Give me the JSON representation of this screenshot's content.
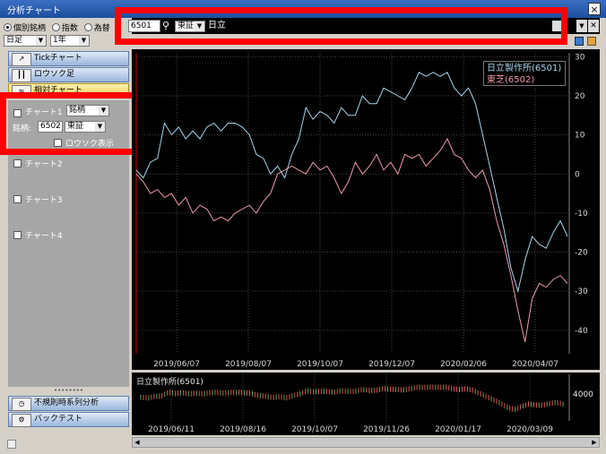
{
  "window": {
    "title": "分析チャート",
    "close": "×"
  },
  "top_controls": {
    "radio_individual": "個別銘柄",
    "radio_index": "指数",
    "radio_fx": "為替",
    "period_value": "日足",
    "range_value": "1年"
  },
  "nav": {
    "tick": "Tickチャート",
    "candle": "ロウソク足",
    "compare": "相対チャート"
  },
  "chart_list": {
    "chart1": "チャート1",
    "chart1_type": "銘柄",
    "code_label": "銘柄:",
    "chart1_code": "6502",
    "chart1_market": "東証",
    "candle_display": "ロウソク表示",
    "chart2": "チャート2",
    "chart3": "チャート3",
    "chart4": "チャート4"
  },
  "bottom_nav": {
    "irregular": "不規則時系列分析",
    "backtest": "バックテスト"
  },
  "search": {
    "code": "6501",
    "market": "東証",
    "name": "日立"
  },
  "chart_data": [
    {
      "type": "line",
      "legend_placement": "top-right",
      "ylim": [
        -46,
        31
      ],
      "yticks": [
        30,
        20,
        10,
        0,
        -10,
        -20,
        -30,
        -40
      ],
      "xtick_labels": [
        "2019/06/07",
        "2019/08/07",
        "2019/10/07",
        "2019/12/07",
        "2020/02/06",
        "2020/04/07"
      ],
      "grid": true,
      "colors": {
        "hitachi": "#a8d4ea",
        "toshiba": "#ef9aa8"
      },
      "series": [
        {
          "name": "日立製作所(6501)",
          "values": [
            1,
            -1,
            3,
            4,
            13,
            10,
            12,
            9,
            11,
            9,
            12,
            13,
            11,
            13,
            13,
            12,
            10,
            5,
            4,
            0,
            2,
            -1,
            5,
            9,
            17,
            14,
            16,
            15,
            13,
            17,
            15,
            15,
            20,
            18,
            18,
            22,
            21,
            20,
            19,
            22,
            26,
            25,
            26,
            25,
            26,
            22,
            20,
            22,
            18,
            10,
            2,
            -6,
            -14,
            -24,
            -30,
            -22,
            -16,
            -18,
            -19,
            -15,
            -12,
            -16
          ]
        },
        {
          "name": "東芝(6502)",
          "values": [
            0,
            -2,
            -5,
            -4,
            -6,
            -5,
            -8,
            -6,
            -10,
            -8,
            -9,
            -12,
            -11,
            -12,
            -10,
            -9,
            -8,
            -10,
            -7,
            -5,
            0,
            1,
            2,
            1,
            0,
            3,
            1,
            2,
            -1,
            -5,
            -2,
            3,
            0,
            2,
            5,
            1,
            3,
            0,
            5,
            4,
            5,
            2,
            4,
            6,
            9,
            5,
            4,
            1,
            -1,
            1,
            -4,
            -12,
            -18,
            -26,
            -35,
            -43,
            -32,
            -28,
            -29,
            -27,
            -26,
            -28
          ]
        }
      ]
    },
    {
      "type": "bar",
      "title": "日立製作所(6501)",
      "ytick": "4000",
      "xtick_labels": [
        "2019/06/11",
        "2019/08/16",
        "2019/10/07",
        "2019/11/26",
        "2020/01/17",
        "2020/03/09"
      ]
    }
  ]
}
